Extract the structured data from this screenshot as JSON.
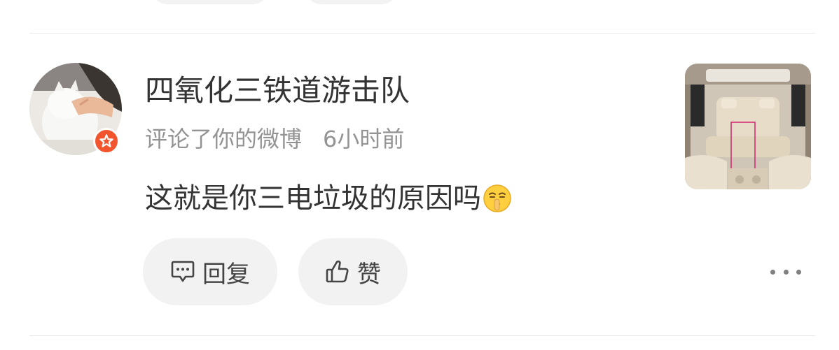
{
  "comment": {
    "username": "四氧化三铁道游击队",
    "action_text": "评论了你的微博",
    "time": "6小时前",
    "content": "这就是你三电垃圾的原因吗",
    "content_emoji": "shush-face-emoji"
  },
  "actions": {
    "reply_label": "回复",
    "like_label": "赞"
  },
  "colors": {
    "badge": "#f2542d",
    "text_primary": "#333333",
    "text_secondary": "#939393",
    "button_bg": "#f2f2f2"
  }
}
